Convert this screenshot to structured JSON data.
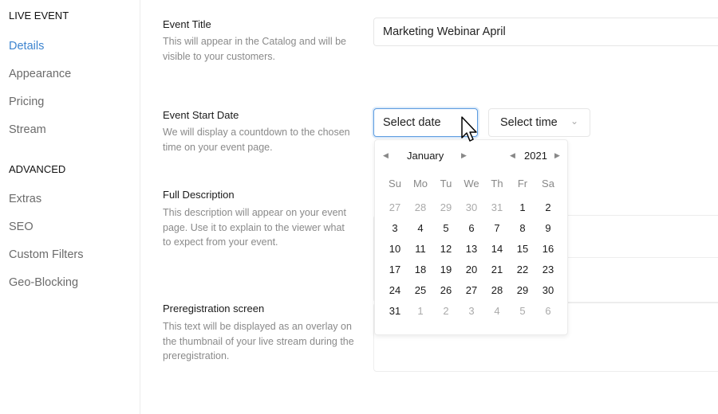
{
  "sidebar": {
    "sections": [
      {
        "title": "LIVE EVENT",
        "items": [
          "Details",
          "Appearance",
          "Pricing",
          "Stream"
        ]
      },
      {
        "title": "ADVANCED",
        "items": [
          "Extras",
          "SEO",
          "Custom Filters",
          "Geo-Blocking"
        ]
      }
    ],
    "active": "Details",
    "accent": "#3d84cf"
  },
  "form": {
    "title": {
      "label": "Event Title",
      "desc": "This will appear in the Catalog and will be visible to your customers.",
      "value": "Marketing Webinar April"
    },
    "start": {
      "label": "Event Start Date",
      "desc": "We will display a countdown to the chosen time on your event page.",
      "date_placeholder": "Select date",
      "time_placeholder": "Select time"
    },
    "description": {
      "label": "Full Description",
      "desc": "This description will appear on your event page. Use it to explain to the viewer what to expect from your event."
    },
    "prereg": {
      "label": "Preregistration screen",
      "desc": "This text will be displayed as an overlay on the thumbnail of your live stream during the preregistration."
    }
  },
  "calendar": {
    "month": "January",
    "year": "2021",
    "weekdays": [
      "Su",
      "Mo",
      "Tu",
      "We",
      "Th",
      "Fr",
      "Sa"
    ],
    "weeks": [
      [
        "27",
        "28",
        "29",
        "30",
        "31",
        "1",
        "2"
      ],
      [
        "3",
        "4",
        "5",
        "6",
        "7",
        "8",
        "9"
      ],
      [
        "10",
        "11",
        "12",
        "13",
        "14",
        "15",
        "16"
      ],
      [
        "17",
        "18",
        "19",
        "20",
        "21",
        "22",
        "23"
      ],
      [
        "24",
        "25",
        "26",
        "27",
        "28",
        "29",
        "30"
      ],
      [
        "31",
        "1",
        "2",
        "3",
        "4",
        "5",
        "6"
      ]
    ],
    "outside": [
      [
        1,
        1,
        1,
        1,
        1,
        0,
        0
      ],
      [
        0,
        0,
        0,
        0,
        0,
        0,
        0
      ],
      [
        0,
        0,
        0,
        0,
        0,
        0,
        0
      ],
      [
        0,
        0,
        0,
        0,
        0,
        0,
        0
      ],
      [
        0,
        0,
        0,
        0,
        0,
        0,
        0
      ],
      [
        0,
        1,
        1,
        1,
        1,
        1,
        1
      ]
    ]
  }
}
